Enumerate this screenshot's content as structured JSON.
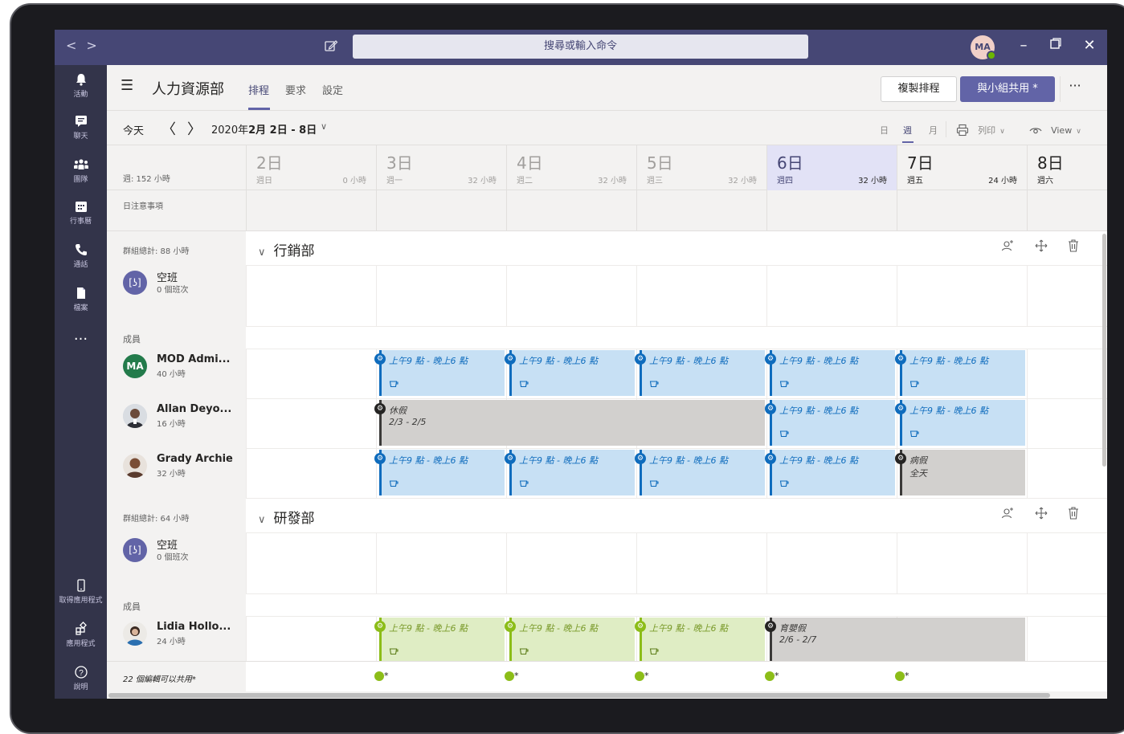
{
  "titlebar": {
    "search_placeholder": "搜尋或輸入命令",
    "avatar_initials": "MA",
    "icons": [
      "back-arrow-icon",
      "forward-arrow-icon",
      "compose-icon",
      "minimize-icon",
      "maximize-icon",
      "close-icon"
    ]
  },
  "rail": {
    "items": [
      {
        "label": "活動",
        "icon": "bell-icon"
      },
      {
        "label": "聊天",
        "icon": "chat-icon"
      },
      {
        "label": "團隊",
        "icon": "teams-icon"
      },
      {
        "label": "行事曆",
        "icon": "calendar-icon"
      },
      {
        "label": "通話",
        "icon": "phone-icon"
      },
      {
        "label": "檔案",
        "icon": "file-icon"
      },
      {
        "label": "...",
        "icon": "more-icon"
      }
    ],
    "bottom": [
      {
        "label": "取得應用程式",
        "icon": "mobile-icon"
      },
      {
        "label": "應用程式",
        "icon": "apps-icon"
      },
      {
        "label": "說明",
        "icon": "help-icon"
      }
    ]
  },
  "header": {
    "team_name": "人力資源部",
    "tabs": [
      {
        "label": "排程"
      },
      {
        "label": "要求"
      },
      {
        "label": "設定"
      }
    ],
    "copy_button": "複製排程",
    "share_button": "與小組共用 *",
    "more": "···"
  },
  "toolbar": {
    "today": "今天",
    "prev": "〈",
    "next": "〉",
    "range_year": "2020年",
    "range": "2月 2日 - 8日",
    "range_chevron": "∨",
    "view_day": "日",
    "view_week": "週",
    "view_month": "月",
    "print": "列印",
    "view": "View"
  },
  "week": {
    "total": "週: 152 小時",
    "notes_label": "日注意事項",
    "days": [
      {
        "num": "2日",
        "name": "週日",
        "hours": "0 小時"
      },
      {
        "num": "3日",
        "name": "週一",
        "hours": "32 小時"
      },
      {
        "num": "4日",
        "name": "週二",
        "hours": "32 小時"
      },
      {
        "num": "5日",
        "name": "週三",
        "hours": "32 小時"
      },
      {
        "num": "6日",
        "name": "週四",
        "hours": "32 小時"
      },
      {
        "num": "7日",
        "name": "週五",
        "hours": "24 小時"
      },
      {
        "num": "8日",
        "name": "週六",
        "hours": ""
      }
    ]
  },
  "groups": [
    {
      "total": "群組總計: 88 小時",
      "name": "行銷部",
      "open_shift": {
        "avatar": "[ʖ]",
        "name": "空班",
        "sub": "0 個班次"
      },
      "members_label": "成員",
      "members": [
        {
          "initials": "MA",
          "name": "MOD Admi...",
          "hours": "40 小時"
        },
        {
          "initials": "",
          "name": "Allan Deyo...",
          "hours": "16 小時"
        },
        {
          "initials": "",
          "name": "Grady Archie",
          "hours": "32 小時"
        }
      ]
    },
    {
      "total": "群組總計: 64 小時",
      "name": "研發部",
      "open_shift": {
        "avatar": "[ʖ]",
        "name": "空班",
        "sub": "0 個班次"
      },
      "members_label": "成員",
      "members": [
        {
          "initials": "",
          "name": "Lidia Hollo...",
          "hours": "24 小時"
        }
      ]
    }
  ],
  "shifts": {
    "work": "上午9 點 - 晚上6 點",
    "vacation": "休假",
    "vacation_range": "2/3 - 2/5",
    "sick": "病假",
    "sick_sub": "全天",
    "parental": "育嬰假",
    "parental_range": "2/6 - 2/7"
  },
  "footer": {
    "label": "22 個編輯可以共用*",
    "mark": "*"
  },
  "colors": {
    "brand": "#6264a7",
    "titlebar": "#464775",
    "rail": "#33344a",
    "shift_blue": "#c7e0f4",
    "shift_green": "#dfedc4",
    "shift_gray": "#d2d0ce"
  }
}
